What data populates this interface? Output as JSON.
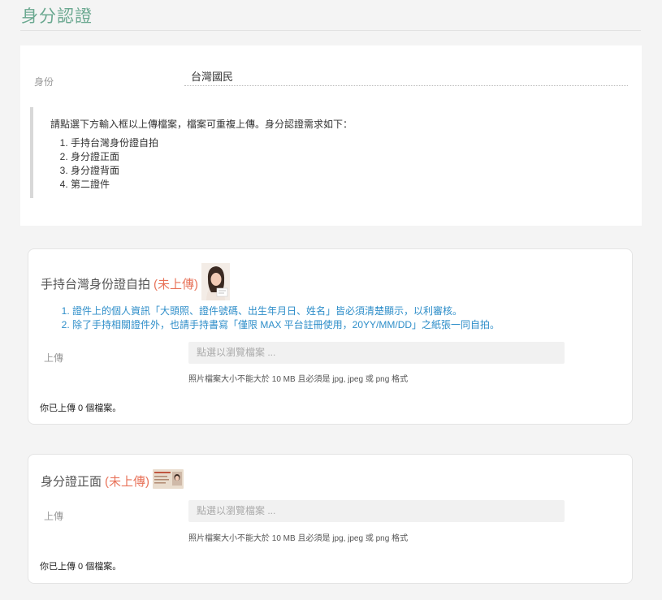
{
  "header": {
    "title": "身分認證"
  },
  "identity": {
    "label": "身份",
    "value": "台灣國民",
    "notice": "請點選下方輸入框以上傳檔案，檔案可重複上傳。身分認證需求如下：",
    "requirements": [
      "手持台灣身份證自拍",
      "身分證正面",
      "身分證背面",
      "第二證件"
    ]
  },
  "cards": [
    {
      "title": "手持台灣身份證自拍",
      "status": "(未上傳)",
      "thumb_icon": "selfie-sample-image",
      "instructions": [
        "證件上的個人資訊「大頭照、證件號碼、出生年月日、姓名」皆必須清楚顯示，以利審核。",
        "除了手持相關證件外，也請手持書寫「僅限 MAX 平台註冊使用，20YY/MM/DD」之紙張一同自拍。"
      ],
      "upload_label": "上傳",
      "upload_placeholder": "點選以瀏覽檔案 ...",
      "hint": "照片檔案大小不能大於 10 MB 且必須是 jpg, jpeg 或 png 格式",
      "count": "你已上傳 0 個檔案。"
    },
    {
      "title": "身分證正面",
      "status": "(未上傳)",
      "thumb_icon": "id-card-front-sample-image",
      "upload_label": "上傳",
      "upload_placeholder": "點選以瀏覽檔案 ...",
      "hint": "照片檔案大小不能大於 10 MB 且必須是 jpg, jpeg 或 png 格式",
      "count": "你已上傳 0 個檔案。"
    }
  ],
  "colors": {
    "title": "#6aa890",
    "status": "#e8735a",
    "instruction": "#2e8ec9"
  }
}
